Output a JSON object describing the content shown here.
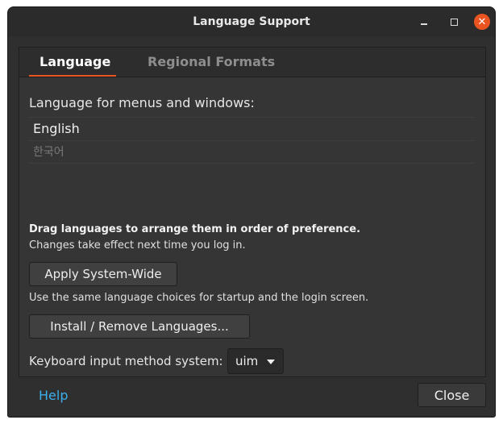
{
  "window": {
    "title": "Language Support"
  },
  "tabs": [
    {
      "label": "Language",
      "active": true
    },
    {
      "label": "Regional Formats",
      "active": false
    }
  ],
  "language_tab": {
    "header": "Language for menus and windows:",
    "languages": [
      "English",
      "한국어"
    ],
    "drag_hint": "Drag languages to arrange them in order of preference.",
    "effect_hint": "Changes take effect next time you log in.",
    "apply_button": "Apply System-Wide",
    "apply_hint": "Use the same language choices for startup and the login screen.",
    "install_button": "Install / Remove Languages...",
    "keyboard_label": "Keyboard input method system:",
    "keyboard_value": "uim"
  },
  "footer": {
    "help_label": "Help",
    "close_label": "Close"
  },
  "colors": {
    "accent": "#e95420",
    "link": "#3daee9"
  },
  "icons": {
    "minimize": "minimize-icon",
    "maximize": "maximize-icon",
    "close": "close-icon",
    "dropdown": "chevron-down-icon"
  }
}
